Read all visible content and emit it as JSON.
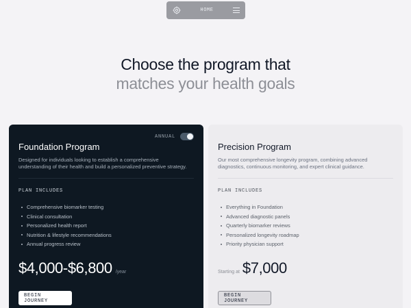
{
  "nav": {
    "logo_icon": "lattice-logo-icon",
    "home_label": "HOME",
    "menu_icon": "hamburger-menu-icon"
  },
  "heading": {
    "line1": "Choose the program that",
    "line2": "matches your health goals"
  },
  "plans": {
    "foundation": {
      "billing_toggle_label": "ANNUAL",
      "billing_toggle_on": true,
      "title": "Foundation Program",
      "description": "Designed for individuals looking to establish a comprehensive understanding of their health and build a personalized preventive strategy.",
      "includes_label": "PLAN INCLUDES",
      "features": [
        "Comprehensive biomarker testing",
        "Clinical consultation",
        "Personalized health report",
        "Nutrition & lifestyle recommendations",
        "Annual progress review"
      ],
      "price": "$4,000-$6,800",
      "period": "/year",
      "cta": "BEGIN JOURNEY"
    },
    "precision": {
      "title": "Precision Program",
      "description": "Our most comprehensive longevity program, combining advanced diagnostics, continuous monitoring, and expert clinical guidance.",
      "includes_label": "PLAN INCLUDES",
      "features": [
        "Everything in Foundation",
        "Advanced diagnostic panels",
        "Quarterly biomarker reviews",
        "Personalized longevity roadmap",
        "Priority physician support"
      ],
      "price_prefix": "Starting at",
      "price": "$7,000",
      "cta": "BEGIN JOURNEY"
    }
  },
  "colors": {
    "page_bg": "#f4f3f6",
    "dark_card_bg": "#0e1822",
    "light_card_bg": "#edecef",
    "heading_primary": "#111827",
    "heading_muted": "#8d8f96"
  }
}
